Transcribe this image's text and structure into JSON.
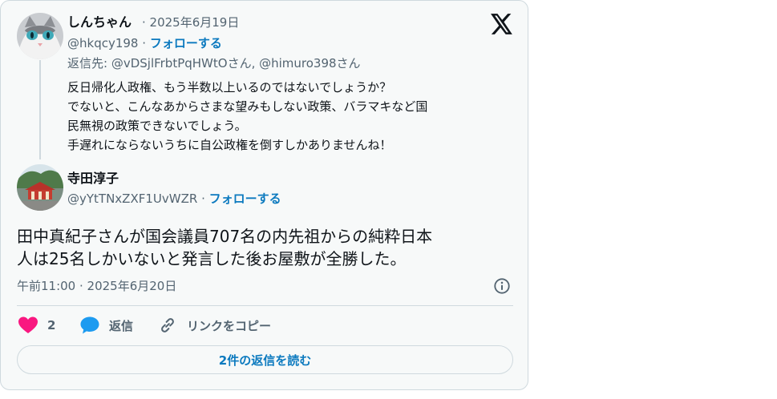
{
  "parent": {
    "display_name": "しんちゃん",
    "date": "· 2025年6月19日",
    "handle": "@hkqcy198",
    "dot": "·",
    "follow_label": "フォローする",
    "reply_to": "返信先: @vDSjlFrbtPqHWtOさん, @himuro398さん",
    "text_lines": [
      "反日帰化人政権、もう半数以上いるのではないでしょうか？",
      "でないと、こんなあからさまな望みもしない政策、バラマキなど国",
      "民無視の政策できないでしょう。",
      "手遅れにならないうちに自公政権を倒すしかありませんね！"
    ]
  },
  "main": {
    "display_name": "寺田淳子",
    "handle": "@yYtTNxZXF1UvWZR",
    "dot": "·",
    "follow_label": "フォローする",
    "text_lines": [
      "田中真紀子さんが国会議員707名の内先祖からの純粋日本",
      "人は25名しかいないと発言した後お屋敷が全勝した。"
    ],
    "timestamp": "午前11:00 · 2025年6月20日"
  },
  "actions": {
    "like_count": "2",
    "reply_label": "返信",
    "copy_link_label": "リンクをコピー"
  },
  "read_replies_label": "2件の返信を読む",
  "icons": [
    "x-logo-icon",
    "info-icon",
    "heart-icon",
    "reply-bubble-icon",
    "link-icon"
  ],
  "colors": {
    "accent": "#0c7abf",
    "like": "#f91880",
    "muted": "#536471",
    "text": "#0f1419"
  }
}
